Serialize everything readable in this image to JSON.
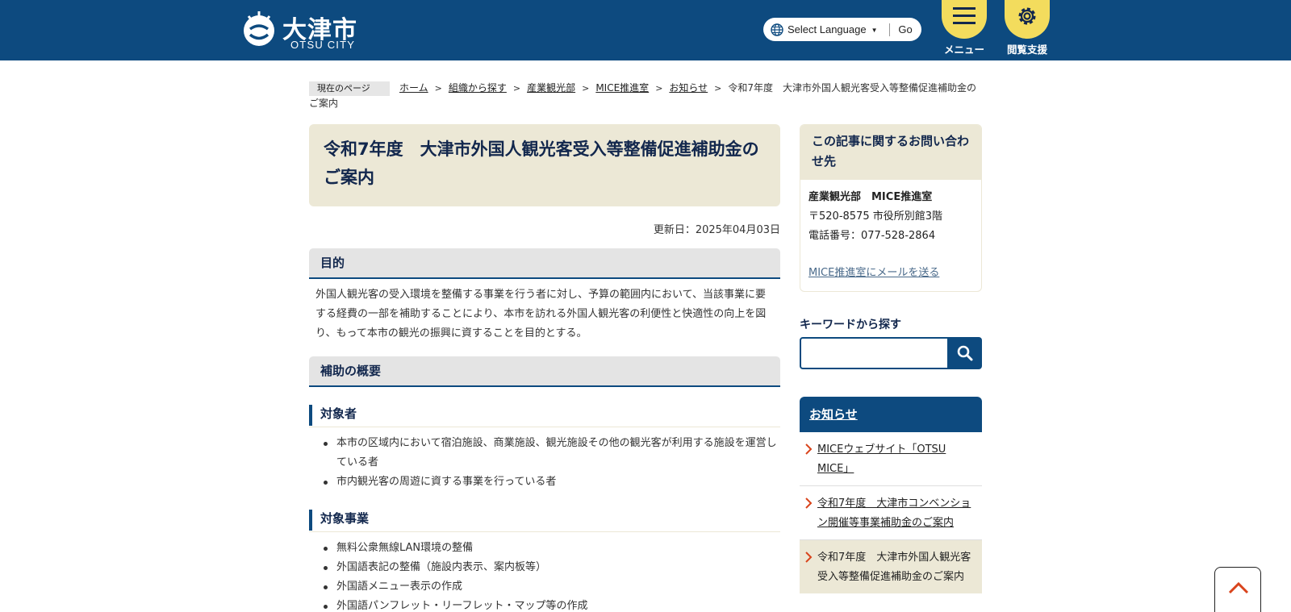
{
  "header": {
    "logo_jp": "大津市",
    "logo_en": "OTSU CITY",
    "language_select": "Select Language",
    "language_go": "Go",
    "menu_label": "メニュー",
    "accessibility_label": "閲覧支援",
    "brand_color": "#0d4a7f",
    "button_color": "#f3dc5d"
  },
  "breadcrumb": {
    "tag": "現在のページ",
    "items": [
      "ホーム",
      "組織から探す",
      "産業観光部",
      "MICE推進室",
      "お知らせ"
    ],
    "current": "令和7年度　大津市外国人観光客受入等整備促進補助金のご案内"
  },
  "article": {
    "title": "令和7年度　大津市外国人観光客受入等整備促進補助金のご案内",
    "updated": "更新日：2025年04月03日",
    "purpose_heading": "目的",
    "purpose_text": "外国人観光客の受入環境を整備する事業を行う者に対し、予算の範囲内において、当該事業に要する経費の一部を補助することにより、本市を訪れる外国人観光客の利便性と快適性の向上を図り、もって本市の観光の振興に資することを目的とする。",
    "overview_heading": "補助の概要",
    "target_heading": "対象者",
    "target_items": [
      "本市の区域内において宿泊施設、商業施設、観光施設その他の観光客が利用する施設を運営している者",
      "市内観光客の周遊に資する事業を行っている者"
    ],
    "project_heading": "対象事業",
    "project_items": [
      "無料公衆無線LAN環境の整備",
      "外国語表記の整備（施設内表示、案内板等）",
      "外国語メニュー表示の作成",
      "外国語パンフレット・リーフレット・マップ等の作成"
    ]
  },
  "sidebar": {
    "contact_heading": "この記事に関するお問い合わせ先",
    "contact_dept": "産業観光部　MICE推進室",
    "contact_address": "〒520-8575 市役所別館3階",
    "contact_phone": "電話番号：077-528-2864",
    "contact_mail": "MICE推進室にメールを送る",
    "keyword_label": "キーワードから探す",
    "keyword_placeholder": "",
    "news_heading": "お知らせ",
    "news_items": [
      "MICEウェブサイト「OTSU MICE」",
      "令和7年度　大津市コンベンション開催等事業補助金のご案内",
      "令和7年度　大津市外国人観光客受入等整備促進補助金のご案内"
    ]
  },
  "icons": {
    "globe": "globe-icon",
    "menu": "hamburger-icon",
    "accessibility": "gear-icon",
    "search": "search-icon",
    "arrow": "chevron-right-icon",
    "pagetop": "chevron-up-icon"
  }
}
